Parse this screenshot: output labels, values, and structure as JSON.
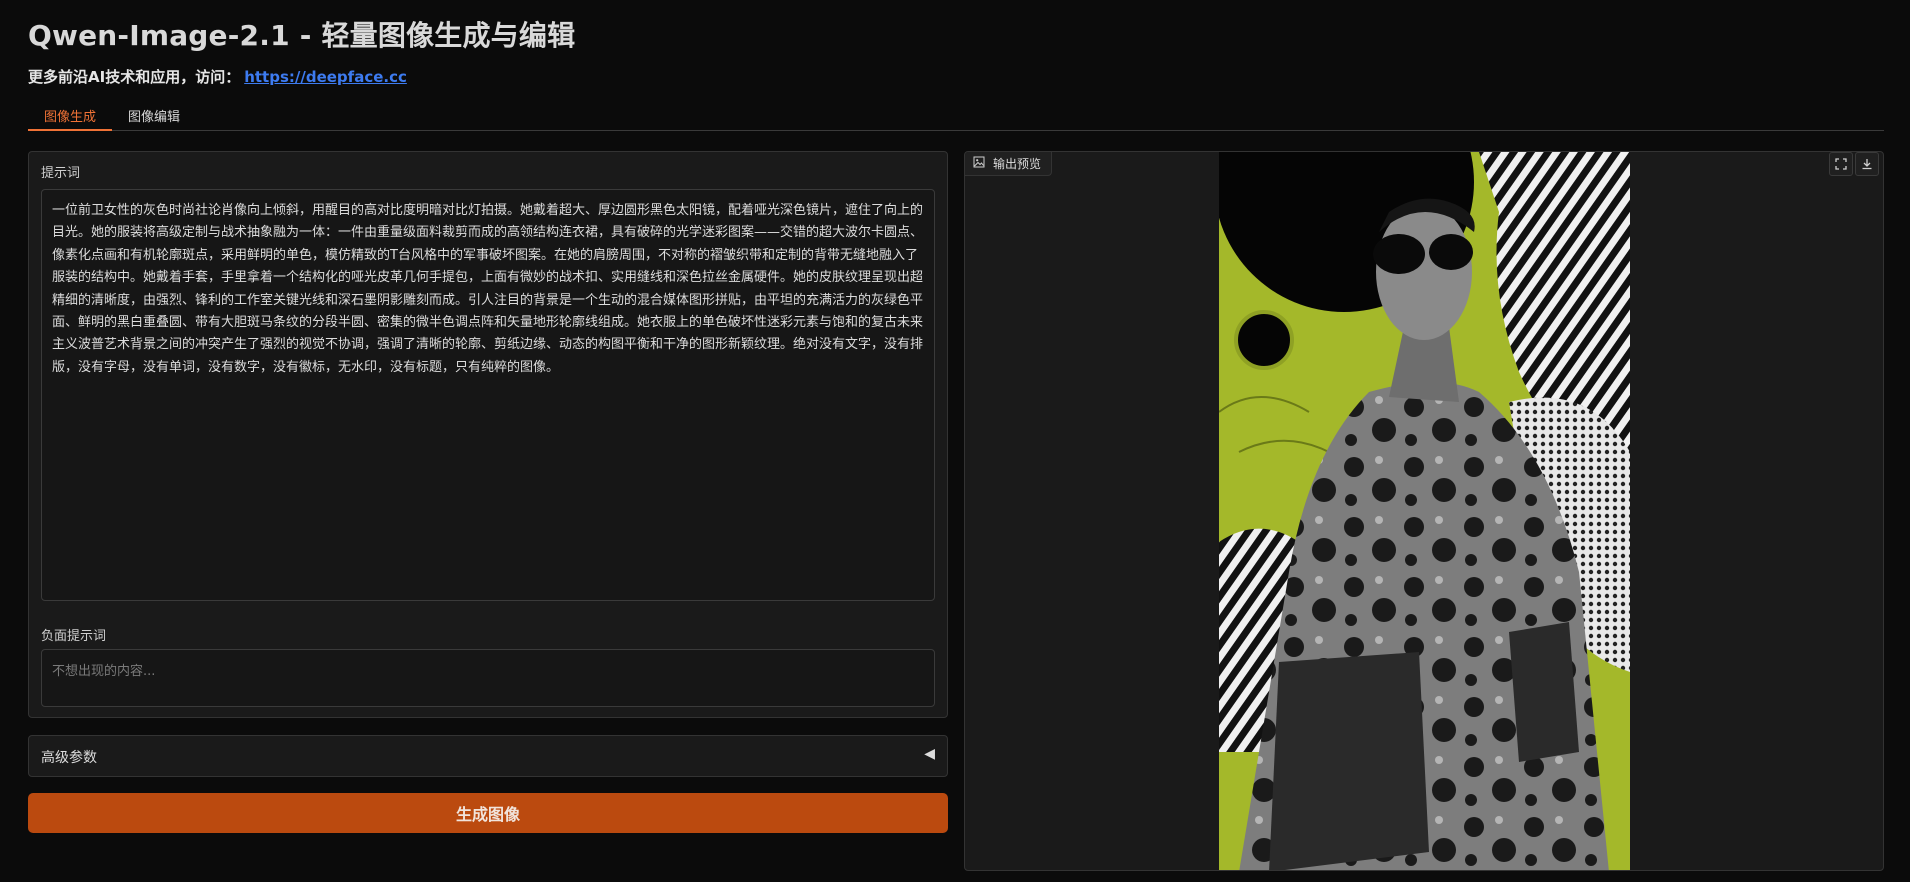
{
  "app": {
    "title": "Qwen-Image-2.1 - 轻量图像生成与编辑",
    "subtitle_prefix": "更多前沿AI技术和应用，访问：",
    "subtitle_link": "https://deepface.cc"
  },
  "tabs": [
    {
      "label": "图像生成",
      "active": true
    },
    {
      "label": "图像编辑",
      "active": false
    }
  ],
  "form": {
    "prompt_label": "提示词",
    "prompt_value": "一位前卫女性的灰色时尚社论肖像向上倾斜，用醒目的高对比度明暗对比灯拍摄。她戴着超大、厚边圆形黑色太阳镜，配着哑光深色镜片，遮住了向上的目光。她的服装将高级定制与战术抽象融为一体：一件由重量级面料裁剪而成的高领结构连衣裙，具有破碎的光学迷彩图案——交错的超大波尔卡圆点、像素化点画和有机轮廓斑点，采用鲜明的单色，模仿精致的T台风格中的军事破坏图案。在她的肩膀周围，不对称的褶皱织带和定制的背带无缝地融入了服装的结构中。她戴着手套，手里拿着一个结构化的哑光皮革几何手提包，上面有微妙的战术扣、实用缝线和深色拉丝金属硬件。她的皮肤纹理呈现出超精细的清晰度，由强烈、锋利的工作室关键光线和深石墨阴影雕刻而成。引人注目的背景是一个生动的混合媒体图形拼贴，由平坦的充满活力的灰绿色平面、鲜明的黑白重叠圆、带有大胆斑马条纹的分段半圆、密集的微半色调点阵和矢量地形轮廓线组成。她衣服上的单色破坏性迷彩元素与饱和的复古未来主义波普艺术背景之间的冲突产生了强烈的视觉不协调，强调了清晰的轮廓、剪纸边缘、动态的构图平衡和干净的图形新颖纹理。绝对没有文字，没有排版，没有字母，没有单词，没有数字，没有徽标，无水印，没有标题，只有纯粹的图像。",
    "negative_label": "负面提示词",
    "negative_placeholder": "不想出现的内容..."
  },
  "advanced": {
    "label": "高级参数",
    "arrow": "◀"
  },
  "generate_button": "生成图像",
  "output": {
    "label": "输出预览"
  },
  "colors": {
    "accent": "#f07236",
    "button": "#bb4a0f",
    "panel": "#1a1a1a",
    "background": "#0b0b0b",
    "link": "#3d7bf0",
    "art_green": "#a4b82a"
  },
  "icons": [
    "image-icon",
    "fullscreen-icon",
    "download-icon"
  ]
}
